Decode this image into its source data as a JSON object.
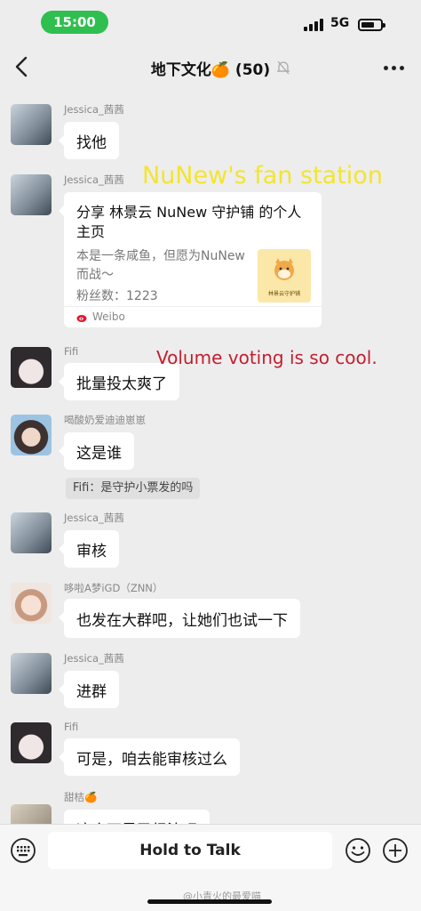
{
  "status_bar": {
    "time": "15:00",
    "network": "5G"
  },
  "header": {
    "title": "地下文化🍊 (50)"
  },
  "messages": [
    {
      "sender": "Jessica_茜茜",
      "text": "找他"
    },
    {
      "sender": "Jessica_茜茜",
      "card": {
        "title": "分享 林景云 NuNew 守护铺 的个人主页",
        "desc": "本是一条咸鱼，但愿为NuNew而战～",
        "fans": "粉丝数：1223",
        "thumb_text": "林景云守护铺",
        "source": "Weibo"
      }
    },
    {
      "sender": "Fifi",
      "text": "批量投太爽了"
    },
    {
      "sender": "喝酸奶爱迪迪崽崽",
      "text": "这是谁"
    },
    {
      "system": "Fifi：是守护小票发的吗"
    },
    {
      "sender": "Jessica_茜茜",
      "text": "审核"
    },
    {
      "sender": "哆啦A梦iGD（ZNN）",
      "text": "也发在大群吧，让她们也试一下"
    },
    {
      "sender": "Jessica_茜茜",
      "text": "进群"
    },
    {
      "sender": "Fifi",
      "text": "可是，咱去能审核过么"
    },
    {
      "sender": "甜桔🍊",
      "text": "这个不是已经注吧"
    }
  ],
  "overlays": {
    "yellow": "NuNew's fan station",
    "red": "Volume voting is so cool."
  },
  "input_bar": {
    "talk_label": "Hold to Talk"
  },
  "watermark": "@小青火的最爱喵"
}
